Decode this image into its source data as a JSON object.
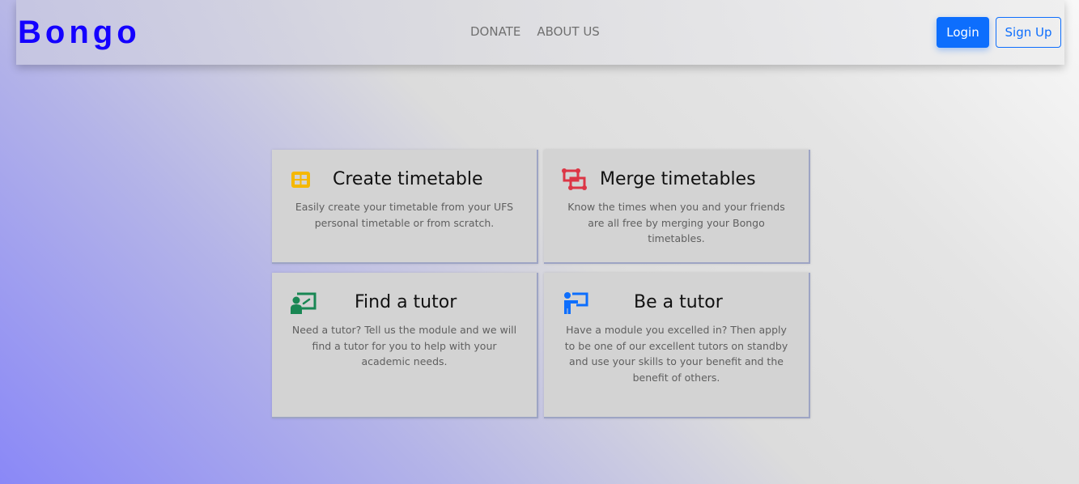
{
  "navbar": {
    "brand": "Bongo",
    "links": [
      "DONATE",
      "ABOUT US"
    ],
    "login_label": "Login",
    "signup_label": "Sign Up"
  },
  "cards": [
    {
      "title": "Create timetable",
      "icon": "table-icon",
      "icon_color": "#f5b800",
      "text": "Easily create your timetable from your UFS personal timetable or from scratch."
    },
    {
      "title": "Merge timetables",
      "icon": "merge-icon",
      "icon_color": "#dc3545",
      "text": "Know the times when you and your friends are all free by merging your Bongo timetables."
    },
    {
      "title": "Find a tutor",
      "icon": "student-board-icon",
      "icon_color": "#198754",
      "text": "Need a tutor? Tell us the module and we will find a tutor for you to help with your academic needs."
    },
    {
      "title": "Be a tutor",
      "icon": "teacher-board-icon",
      "icon_color": "#0d6efd",
      "text": "Have a module you excelled in? Then apply to be one of our excellent tutors on standby and use your skills to your benefit and the benefit of others."
    }
  ],
  "colors": {
    "brand": "#1400ff",
    "primary": "#0d6efd",
    "card_bg": "#d3d3d3"
  }
}
